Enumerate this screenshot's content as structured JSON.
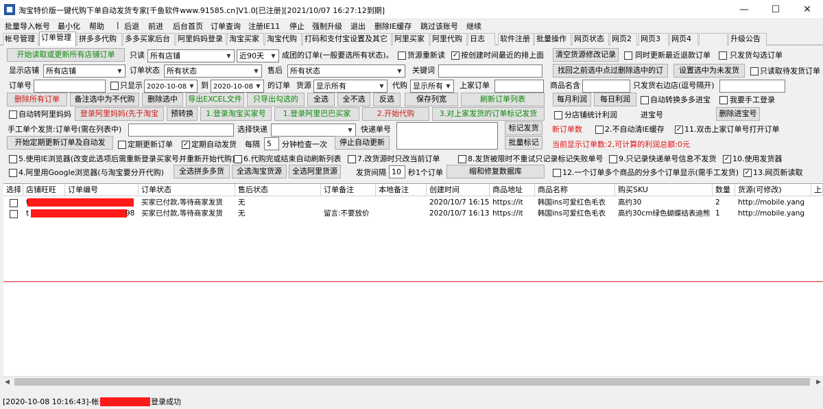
{
  "title": "淘宝特价版一键代购下单自动发货专家[千鱼软件www.91585.cn]V1.0[已注册][2021/10/07 16:27:12到期]",
  "window": {
    "min": "—",
    "max": "☐",
    "close": "✕"
  },
  "menu": [
    "批量导入帐号",
    "最小化",
    "帮助",
    "|",
    "后退",
    "前进",
    "后台首页",
    "订单查询",
    "注册IE11",
    "停止",
    "强制升级",
    "退出",
    "删除IE缓存",
    "跳过该账号",
    "继续"
  ],
  "tabs": [
    "帐号管理",
    "订单管理",
    "拼多多代购",
    "多多买家后台",
    "阿里妈妈登录",
    "淘宝买家",
    "淘宝代购",
    "打码和支付宝设置及其它",
    "阿里买家",
    "阿里代购",
    "日志",
    "软件注册",
    "批量操作",
    "网页状态",
    "网页2",
    "网页3",
    "网页4",
    "",
    "升级公告"
  ],
  "controls": {
    "btn_fetch": "开始读取或更新所有店铺订单",
    "lbl_only": "只读",
    "sel_store": "所有店铺",
    "sel_days": "近90天",
    "lbl_success": "成团的订单(一般要选所有状态)。",
    "chk_reread": "货源重新读",
    "chk_sort": "按创建时间最近的排上面",
    "btn_clear_src": "清空货源修改记录",
    "chk_sync_refund": "同时更新最近退款订单",
    "chk_only_checked": "只发货勾选订单",
    "lbl_show_store": "显示店铺",
    "sel_show_store": "所有店铺",
    "lbl_order_status": "订单状态",
    "sel_order_status": "所有状态",
    "lbl_aftersale": "售后",
    "sel_aftersale": "所有状态",
    "lbl_keyword": "关键词",
    "btn_return_deleted": "找回之前选中点过删除选中的订",
    "btn_set_unshipped": "设置选中为未发货",
    "chk_only_pending": "只读取待发货订单",
    "lbl_order_no": "订单号",
    "chk_only_show": "只显示",
    "date_from": "2020-10-08",
    "lbl_to": "到",
    "date_to": "2020-10-08",
    "lbl_of_orders": "的订单",
    "lbl_source": "货源",
    "sel_source": "显示所有",
    "lbl_proxy": "代购",
    "sel_proxy": "显示所有",
    "lbl_upstream": "上家订单",
    "lbl_product": "商品名含",
    "lbl_ship_right": "只发货右边店(逗号隔开)",
    "btn_delete_all": "删除所有订单",
    "btn_note_nonproxy": "备注选中为不代购",
    "btn_delete_sel": "删除选中",
    "btn_export": "导出EXCEL文件",
    "btn_export_checked": "只导出勾选的",
    "btn_selall": "全选",
    "btn_selnone": "全不选",
    "btn_invert": "反选",
    "btn_save_cols": "保存列宽",
    "btn_refresh": "刷新订单列表",
    "btn_monthly": "每月利润",
    "btn_daily": "每日利润",
    "chk_auto_pdd": "自动转换多多进宝",
    "chk_manual_login": "我要手工登录",
    "chk_auto_alimama": "自动转阿里妈妈",
    "btn_login_alimama": "登录阿里妈妈(先于淘宝",
    "btn_convert": "预转换",
    "btn_login_tb": "1.登录淘宝买家号",
    "btn_login_ali": "1.登录阿里巴巴买家",
    "btn_start_proxy": "2.开始代购",
    "btn_mark_ship": "3.对上家发货的订单标记发货",
    "chk_store_profit": "分店铺统计利润",
    "lbl_jinbao": "进宝号",
    "btn_del_jinbao": "删除进宝号",
    "lbl_manual_ship": "手工单个发货:订单号(需在列表中)",
    "lbl_express": "选择快递",
    "lbl_tracking": "快递单号",
    "btn_mark": "标记发货",
    "lbl_new_orders": "新订单数",
    "chk_no_clear_ie": "2.不自动清IE缓存",
    "chk_dblclick": "11.双击上家订单号打开订单",
    "btn_timed": "开始定期更新订单及自动发",
    "chk_timed_update": "定期更新订单",
    "chk_timed_ship": "定期自动发货",
    "lbl_every": "每隔",
    "val_interval": "5",
    "lbl_check": "分钟检查一次",
    "btn_stop_auto": "停止自动更新",
    "btn_batch_mark": "批量标记",
    "lbl_profit": "当前显示订单数:2,可计算的利润总额:0元",
    "chk_ie": "5.使用IE浏览器(改变此选项后需重新登录买家号并重新开始代购)",
    "chk_refresh_after": "6.代购完或结束自动刷新列表",
    "chk_change_src": "7.改货源时只改当前订单",
    "chk_8": "8.发货被限时不重试只记录标记失败单号",
    "chk_9": "9.只记录快递单号信息不发货",
    "chk_10": "10.使用发货器",
    "chk_google": "4.阿里用Google浏览器(与淘宝要分开代购)",
    "btn_sel_pdd": "全选拼多多货",
    "btn_sel_tb": "全选淘宝货源",
    "btn_sel_ali": "全选阿里货源",
    "lbl_ship_interval": "发货间隔",
    "val_ship_interval": "10",
    "lbl_per_order": "秒1个订单",
    "btn_repair_db": "缩和修复数据库",
    "chk_12": "12.一个订单多个商品的分多个订单显示(需手工发货)",
    "chk_13": "13.网页新读取"
  },
  "table": {
    "headers": [
      "选择",
      "店铺旺旺",
      "订单编号",
      "订单状态",
      "售后状态",
      "订单备注",
      "本地备注",
      "创建时间",
      "商品地址",
      "商品名称",
      "购买SKU",
      "数量",
      "货源(可修改)",
      "上"
    ],
    "rows": [
      {
        "shop": "t",
        "order": "",
        "status": "买家已付款,等待商家发货",
        "after": "无",
        "note": "",
        "local": "",
        "time": "2020/10/7 16:15",
        "url": "https://it",
        "name": "韩国ins可爱红色毛衣",
        "sku": "高约30",
        "qty": "2",
        "src": "http://mobile.yang"
      },
      {
        "shop": "t",
        "order": "98",
        "status": "买家已付款,等待商家发货",
        "after": "无",
        "note": "留言:不要放价",
        "local": "",
        "time": "2020/10/7 16:13",
        "url": "https://it",
        "name": "韩国ins可爱红色毛衣",
        "sku": "高约30cm绿色蝴蝶结表迪熊",
        "qty": "1",
        "src": "http://mobile.yang"
      }
    ]
  },
  "status": {
    "prefix": "[2020-10-08 10:16:43]-帐号",
    "suffix": "登录成功"
  },
  "colors": {
    "red": "#ff1a1a",
    "green": "#0a8a0a"
  }
}
